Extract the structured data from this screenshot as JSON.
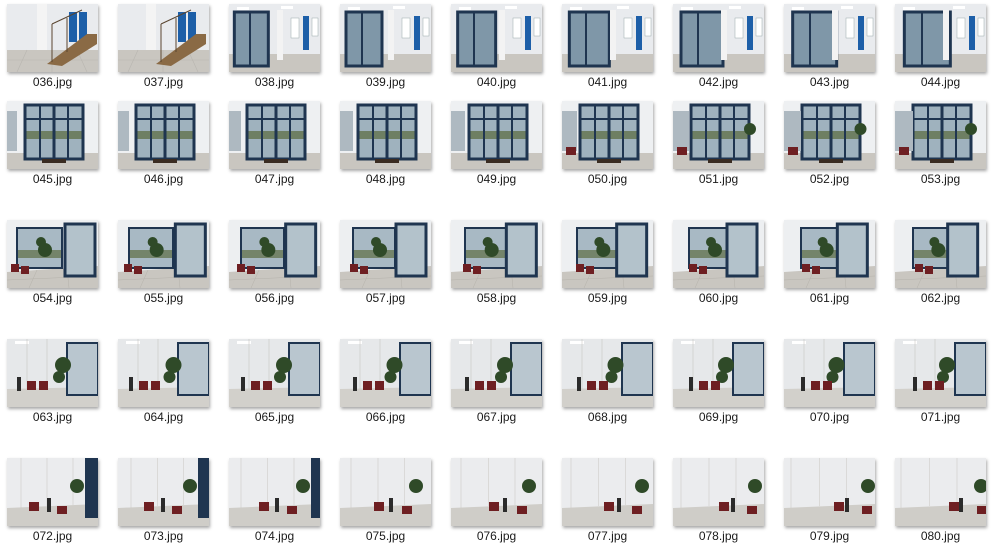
{
  "window": {
    "view": "large-icons"
  },
  "files": [
    {
      "name": "036.jpg",
      "scene": "stairs"
    },
    {
      "name": "037.jpg",
      "scene": "stairs"
    },
    {
      "name": "038.jpg",
      "scene": "hall-doors"
    },
    {
      "name": "039.jpg",
      "scene": "hall-doors"
    },
    {
      "name": "040.jpg",
      "scene": "hall-doors"
    },
    {
      "name": "041.jpg",
      "scene": "hall-doors"
    },
    {
      "name": "042.jpg",
      "scene": "hall-doors"
    },
    {
      "name": "043.jpg",
      "scene": "hall-doors"
    },
    {
      "name": "044.jpg",
      "scene": "hall-doors"
    },
    {
      "name": "045.jpg",
      "scene": "glass-entrance"
    },
    {
      "name": "046.jpg",
      "scene": "glass-entrance"
    },
    {
      "name": "047.jpg",
      "scene": "glass-entrance"
    },
    {
      "name": "048.jpg",
      "scene": "glass-entrance"
    },
    {
      "name": "049.jpg",
      "scene": "glass-entrance"
    },
    {
      "name": "050.jpg",
      "scene": "glass-entrance"
    },
    {
      "name": "051.jpg",
      "scene": "glass-entrance"
    },
    {
      "name": "052.jpg",
      "scene": "glass-entrance"
    },
    {
      "name": "053.jpg",
      "scene": "glass-entrance"
    },
    {
      "name": "054.jpg",
      "scene": "window-corner"
    },
    {
      "name": "055.jpg",
      "scene": "window-corner"
    },
    {
      "name": "056.jpg",
      "scene": "window-corner"
    },
    {
      "name": "057.jpg",
      "scene": "window-corner"
    },
    {
      "name": "058.jpg",
      "scene": "window-corner"
    },
    {
      "name": "059.jpg",
      "scene": "window-corner"
    },
    {
      "name": "060.jpg",
      "scene": "window-corner"
    },
    {
      "name": "061.jpg",
      "scene": "window-corner"
    },
    {
      "name": "062.jpg",
      "scene": "window-corner"
    },
    {
      "name": "063.jpg",
      "scene": "lounge"
    },
    {
      "name": "064.jpg",
      "scene": "lounge"
    },
    {
      "name": "065.jpg",
      "scene": "lounge"
    },
    {
      "name": "066.jpg",
      "scene": "lounge"
    },
    {
      "name": "067.jpg",
      "scene": "lounge"
    },
    {
      "name": "068.jpg",
      "scene": "lounge"
    },
    {
      "name": "069.jpg",
      "scene": "lounge"
    },
    {
      "name": "070.jpg",
      "scene": "lounge"
    },
    {
      "name": "071.jpg",
      "scene": "lounge"
    },
    {
      "name": "072.jpg",
      "scene": "white-wall"
    },
    {
      "name": "073.jpg",
      "scene": "white-wall"
    },
    {
      "name": "074.jpg",
      "scene": "white-wall"
    },
    {
      "name": "075.jpg",
      "scene": "white-wall"
    },
    {
      "name": "076.jpg",
      "scene": "white-wall"
    },
    {
      "name": "077.jpg",
      "scene": "white-wall"
    },
    {
      "name": "078.jpg",
      "scene": "white-wall"
    },
    {
      "name": "079.jpg",
      "scene": "white-wall"
    },
    {
      "name": "080.jpg",
      "scene": "white-wall"
    }
  ],
  "colors": {
    "label_text": "#1a1a1a",
    "frame_blue": "#1f3550",
    "floor": "#c9c6c0",
    "wall": "#e9ebee",
    "chair_red": "#6e1f22",
    "plant_green": "#2f4a28",
    "wood": "#8a6a45"
  }
}
